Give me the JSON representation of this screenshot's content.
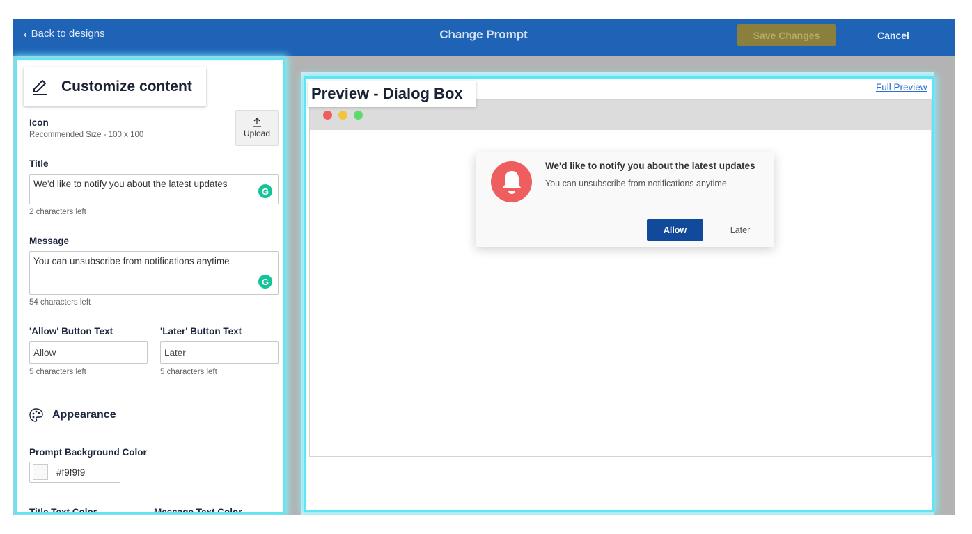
{
  "header": {
    "back_label": "Back to designs",
    "title": "Change Prompt",
    "save_label": "Save Changes",
    "cancel_label": "Cancel"
  },
  "customize": {
    "title": "Customize content",
    "icon_label": "Icon",
    "icon_hint": "Recommended Size - 100 x 100",
    "upload_label": "Upload",
    "title_label": "Title",
    "title_value": "We'd like to notify you about the latest updates",
    "title_counter": "2 characters left",
    "message_label": "Message",
    "message_value": "You can unsubscribe from notifications anytime",
    "message_counter": "54 characters left",
    "allow_label": "'Allow' Button Text",
    "allow_value": "Allow",
    "allow_counter": "5 characters left",
    "later_label": "'Later' Button Text",
    "later_value": "Later",
    "later_counter": "5 characters left",
    "appearance_label": "Appearance",
    "bg_color_label": "Prompt Background Color",
    "bg_color_value": "#f9f9f9",
    "title_color_label": "Title Text Color",
    "message_color_label": "Message Text Color"
  },
  "preview": {
    "title": "Preview - Dialog Box",
    "full_preview_label": "Full Preview",
    "dialog_title": "We'd like to notify you about the latest updates",
    "dialog_message": "You can unsubscribe from notifications anytime",
    "allow_label": "Allow",
    "later_label": "Later"
  },
  "colors": {
    "header_bg": "#1f63b6",
    "highlight": "#5ee6f7",
    "allow_button": "#114a9a",
    "bell": "#ee5e5e",
    "grammarly": "#15c39a"
  },
  "icons": [
    "chevron-left-icon",
    "pencil-icon",
    "upload-icon",
    "grammarly-icon",
    "palette-icon",
    "bell-icon"
  ]
}
